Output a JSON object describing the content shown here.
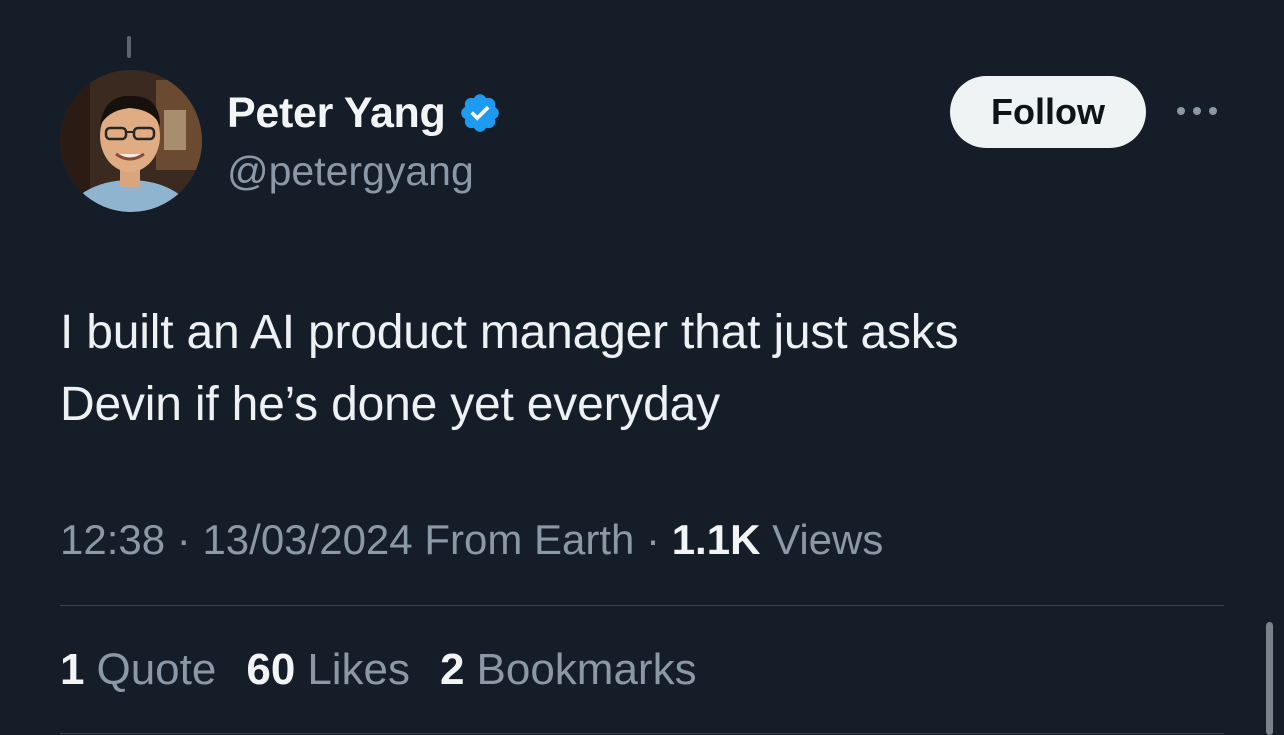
{
  "author": {
    "display_name": "Peter Yang",
    "handle": "@petergyang",
    "verified": true
  },
  "follow_label": "Follow",
  "tweet": {
    "line1": "I built an AI product manager that just asks",
    "line2": "Devin if he’s done yet everyday"
  },
  "meta": {
    "time": "12:38",
    "sep1": " · ",
    "date": "13/03/2024",
    "source": " From Earth",
    "sep2": " · ",
    "views_count": "1.1K",
    "views_label": " Views"
  },
  "stats": {
    "quotes_count": "1",
    "quotes_label": "Quote",
    "likes_count": "60",
    "likes_label": "Likes",
    "bookmarks_count": "2",
    "bookmarks_label": "Bookmarks"
  },
  "colors": {
    "background": "#151d28",
    "verified_badge": "#1d9bf0",
    "muted_text": "#8b98a5"
  },
  "icons": {
    "verified": "verified-badge-icon",
    "more": "more-horizontal-icon"
  }
}
